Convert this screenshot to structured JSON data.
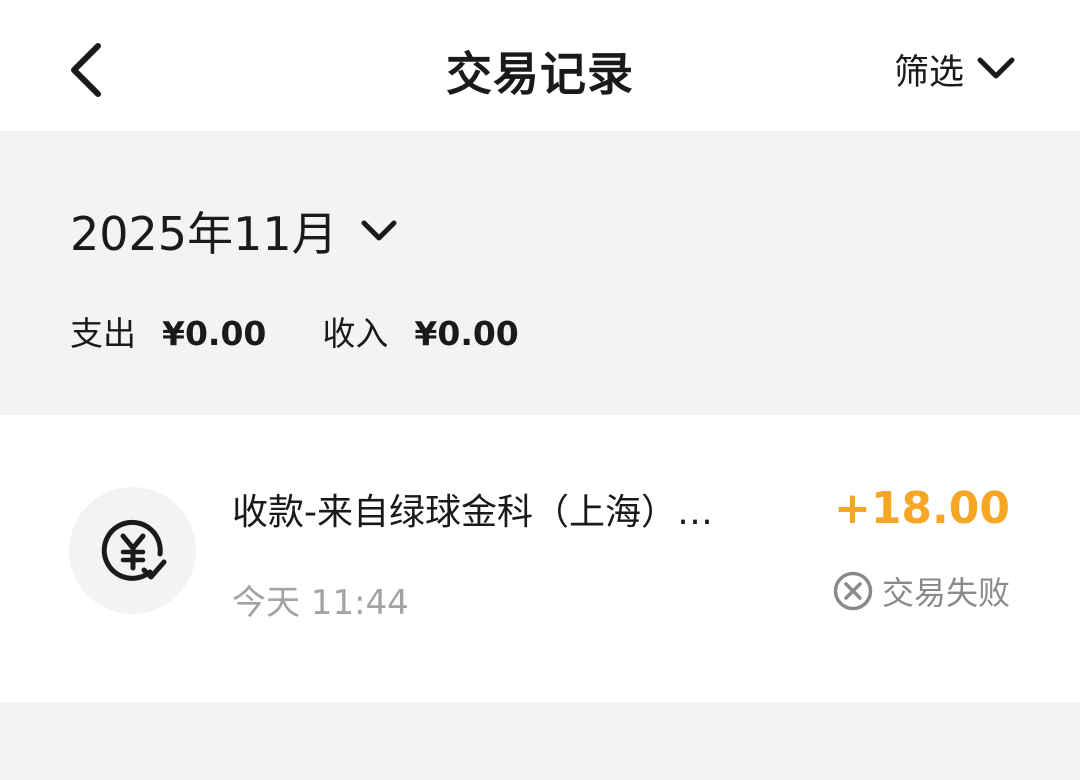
{
  "nav": {
    "title": "交易记录",
    "filter_label": "筛选",
    "back_icon": "chevron-left-icon",
    "filter_icon": "chevron-down-icon"
  },
  "summary": {
    "month_label": "2025年11月",
    "expense_label": "支出",
    "expense_amount": "¥0.00",
    "income_label": "收入",
    "income_amount": "¥0.00"
  },
  "transactions": [
    {
      "icon": "yuan-check-icon",
      "title": "收款-来自绿球金科（上海）…",
      "time": "今天 11:44",
      "amount": "+18.00",
      "amount_color": "#f5a623",
      "status": "交易失败",
      "status_icon": "close-circle-icon"
    }
  ],
  "colors": {
    "accent_amount": "#f5a623",
    "section_bg": "#f3f3f5",
    "muted_text": "#a3a3a3"
  }
}
